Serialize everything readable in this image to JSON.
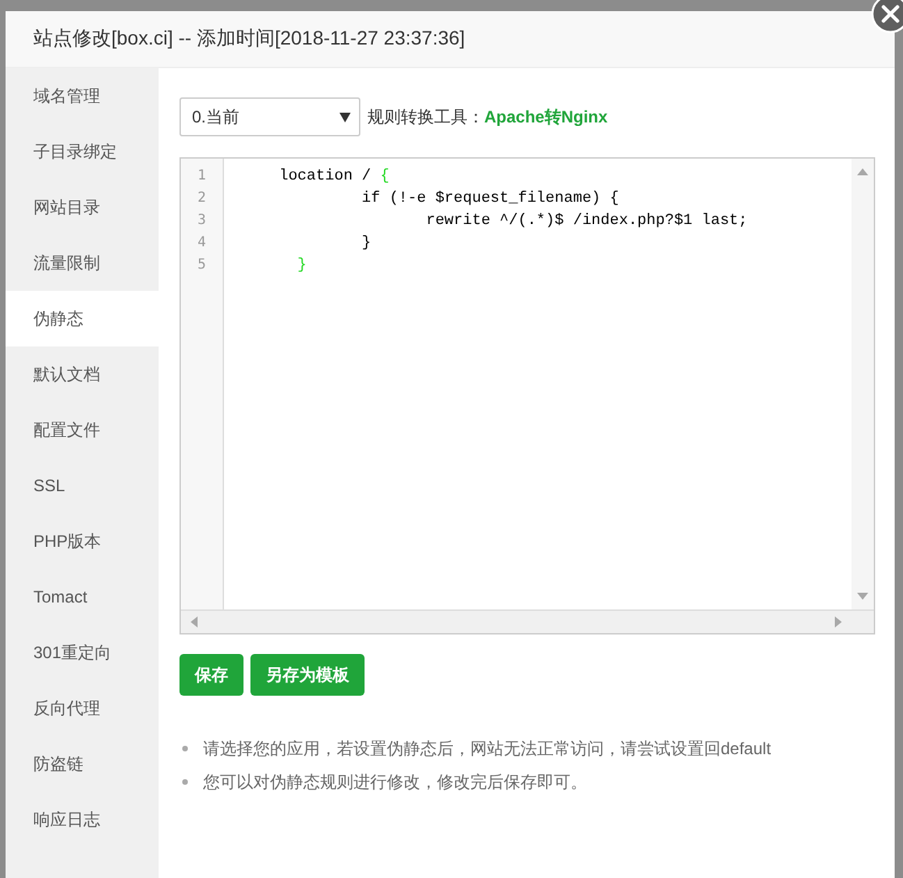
{
  "dialog": {
    "title": "站点修改[box.ci] -- 添加时间[2018-11-27 23:37:36]"
  },
  "sidebar": {
    "items": [
      {
        "label": "域名管理",
        "selected": false
      },
      {
        "label": "子目录绑定",
        "selected": false
      },
      {
        "label": "网站目录",
        "selected": false
      },
      {
        "label": "流量限制",
        "selected": false
      },
      {
        "label": "伪静态",
        "selected": true
      },
      {
        "label": "默认文档",
        "selected": false
      },
      {
        "label": "配置文件",
        "selected": false
      },
      {
        "label": "SSL",
        "selected": false
      },
      {
        "label": "PHP版本",
        "selected": false
      },
      {
        "label": "Tomact",
        "selected": false
      },
      {
        "label": "301重定向",
        "selected": false
      },
      {
        "label": "反向代理",
        "selected": false
      },
      {
        "label": "防盗链",
        "selected": false
      },
      {
        "label": "响应日志",
        "selected": false
      }
    ]
  },
  "toolbar": {
    "select": {
      "value": "0.当前"
    },
    "tool_label": "规则转换工具：",
    "tool_link": "Apache转Nginx"
  },
  "editor": {
    "lines": [
      {
        "number": "1",
        "segments": [
          {
            "kind": "plain",
            "text": "      location / "
          },
          {
            "kind": "bracket",
            "text": "{"
          }
        ]
      },
      {
        "number": "2",
        "segments": [
          {
            "kind": "plain",
            "text": "               if (!-e $request_filename) {"
          }
        ]
      },
      {
        "number": "3",
        "segments": [
          {
            "kind": "plain",
            "text": "                      rewrite ^/(.*)$ /index.php?$1 last;"
          }
        ]
      },
      {
        "number": "4",
        "segments": [
          {
            "kind": "plain",
            "text": "               }"
          }
        ]
      },
      {
        "number": "5",
        "segments": [
          {
            "kind": "bracket",
            "text": "        }"
          }
        ]
      }
    ]
  },
  "buttons": [
    "保存",
    "另存为模板"
  ],
  "notes": [
    "请选择您的应用，若设置伪静态后，网站无法正常访问，请尝试设置回default",
    "您可以对伪静态规则进行修改，修改完后保存即可。"
  ]
}
